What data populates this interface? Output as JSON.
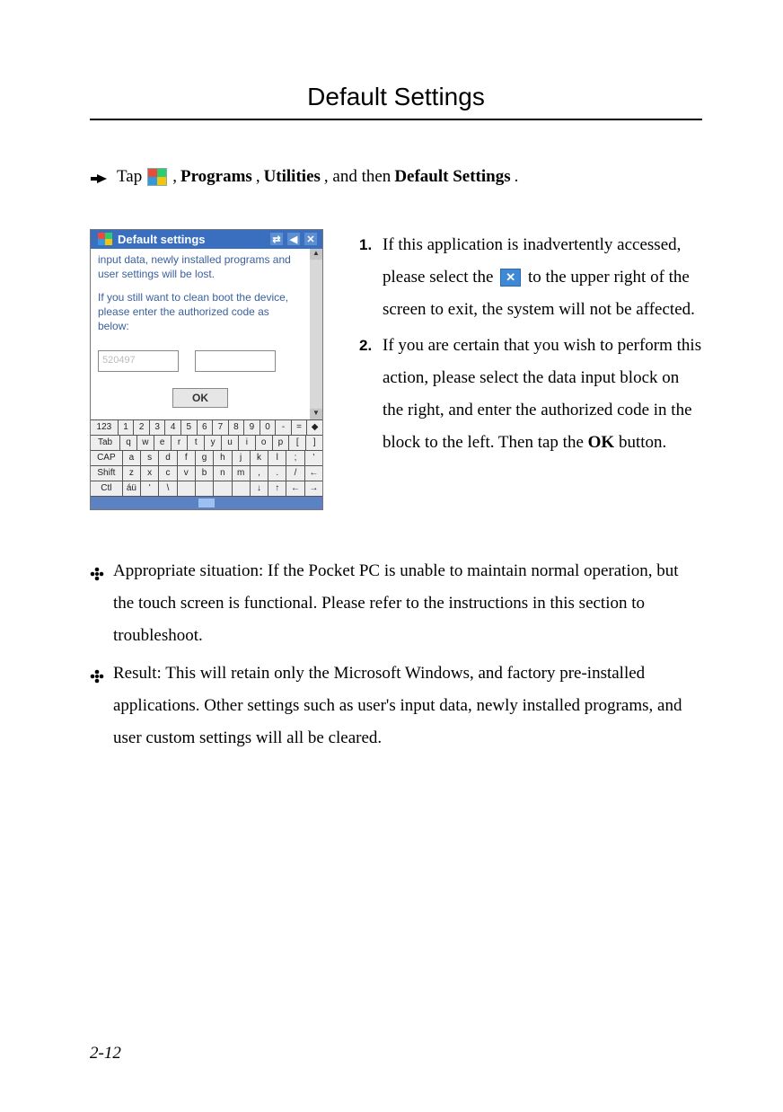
{
  "title": "Default Settings",
  "tapline": {
    "prefix": "Tap",
    "items": [
      "Programs",
      "Utilities",
      "Default Settings"
    ],
    "separator": ", ",
    "and": ", and then "
  },
  "screenshot": {
    "window_title": "Default settings",
    "body_line1": "input data, newly installed programs and user settings will be lost.",
    "body_line2": "If you still want to clean boot the device, please enter the authorized code as below:",
    "input_hint": "520497",
    "ok": "OK",
    "keyboard": {
      "row1": [
        "123",
        "1",
        "2",
        "3",
        "4",
        "5",
        "6",
        "7",
        "8",
        "9",
        "0",
        "-",
        "=",
        "◆"
      ],
      "row2": [
        "Tab",
        "q",
        "w",
        "e",
        "r",
        "t",
        "y",
        "u",
        "i",
        "o",
        "p",
        "[",
        "]"
      ],
      "row3": [
        "CAP",
        "a",
        "s",
        "d",
        "f",
        "g",
        "h",
        "j",
        "k",
        "l",
        ";",
        "'"
      ],
      "row4": [
        "Shift",
        "z",
        "x",
        "c",
        "v",
        "b",
        "n",
        "m",
        ",",
        ".",
        "/",
        "←"
      ],
      "row5": [
        "Ctl",
        "áü",
        "'",
        "\\",
        " ",
        " ",
        " ",
        " ",
        "↓",
        "↑",
        "←",
        "→"
      ]
    }
  },
  "steps": [
    {
      "pre": "If this application is inadvertently accessed, please select the ",
      "post": " to the upper right of the screen to exit, the system will not be affected."
    },
    {
      "text_a": "If you are certain that you wish to perform this action, please select the data input block on the right, and enter the authorized code in the block to the left. Then tap the ",
      "bold": "OK",
      "text_b": " button."
    }
  ],
  "bullets": [
    "Appropriate situation: If the Pocket PC is unable to maintain normal operation, but the touch screen is functional. Please refer to the instructions in this section to troubleshoot.",
    "Result: This will retain only the Microsoft Windows, and factory pre-installed applications. Other settings such as user's input data, newly installed programs, and user custom settings will all be cleared."
  ],
  "page_number": "2-12"
}
